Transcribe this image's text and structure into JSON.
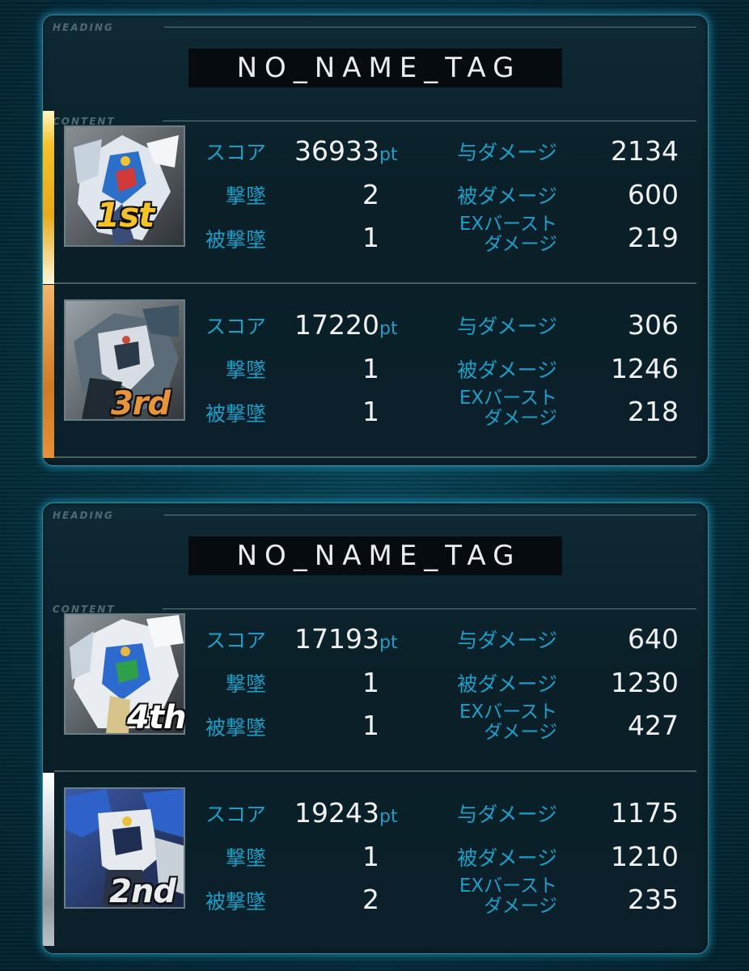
{
  "sections": {
    "heading_label": "HEADING",
    "content_label": "CONTENT"
  },
  "labels": {
    "score": "スコア",
    "kills": "撃墜",
    "deaths": "被撃墜",
    "damage_dealt": "与ダメージ",
    "damage_taken": "被ダメージ",
    "ex_burst_line1": "EXバースト",
    "ex_burst_line2": "ダメージ",
    "pt_unit": "pt"
  },
  "teams": [
    {
      "tag": "NO_NAME_TAG",
      "players": [
        {
          "rank": "1st",
          "rank_color": "gold",
          "score": "36933",
          "kills": "2",
          "deaths": "1",
          "damage_dealt": "2134",
          "damage_taken": "600",
          "ex_burst_damage": "219"
        },
        {
          "rank": "3rd",
          "rank_color": "bronze",
          "score": "17220",
          "kills": "1",
          "deaths": "1",
          "damage_dealt": "306",
          "damage_taken": "1246",
          "ex_burst_damage": "218"
        }
      ]
    },
    {
      "tag": "NO_NAME_TAG",
      "players": [
        {
          "rank": "4th",
          "rank_color": "white",
          "score": "17193",
          "kills": "1",
          "deaths": "1",
          "damage_dealt": "640",
          "damage_taken": "1230",
          "ex_burst_damage": "427"
        },
        {
          "rank": "2nd",
          "rank_color": "silver",
          "score": "19243",
          "kills": "1",
          "deaths": "2",
          "damage_dealt": "1175",
          "damage_taken": "1210",
          "ex_burst_damage": "235"
        }
      ]
    }
  ],
  "colors": {
    "accent_blue": "#1f9fc8",
    "gold": "#f5c227",
    "bronze": "#cf7a24",
    "silver": "#cfd6da",
    "panel_glow": "#28bee6"
  }
}
